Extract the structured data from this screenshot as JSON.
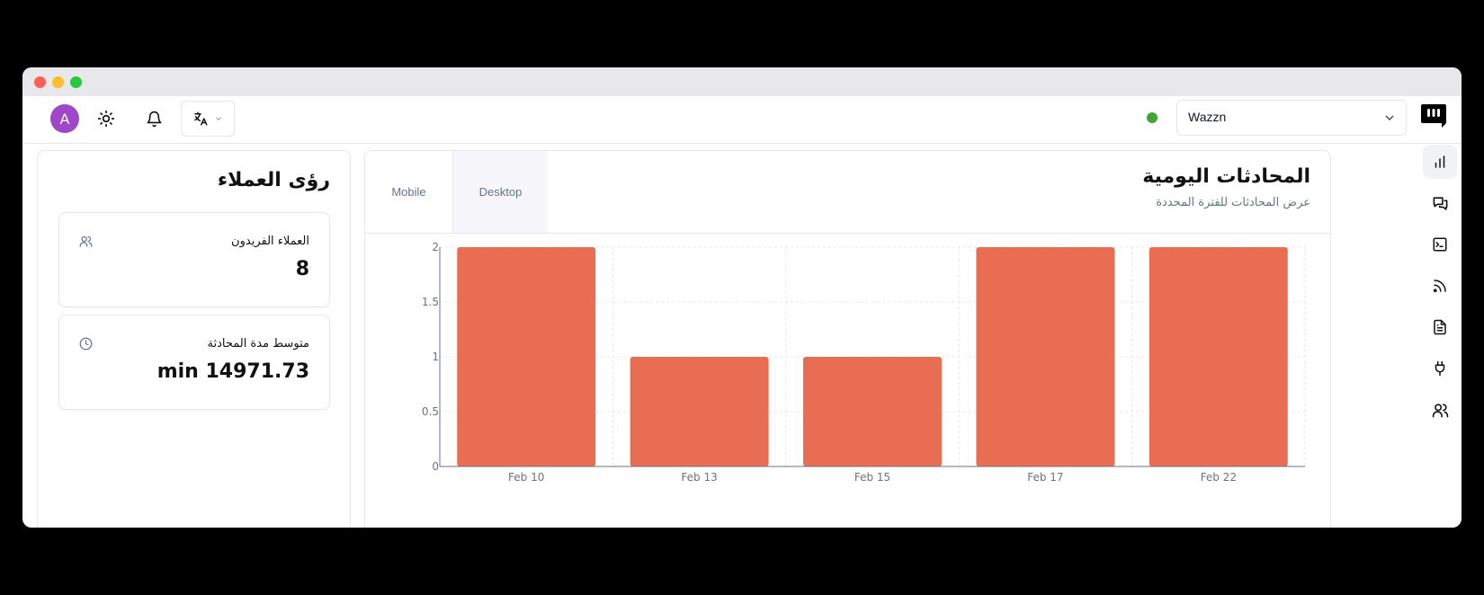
{
  "header": {
    "avatar_letter": "A",
    "workspace_select": "Wazzn",
    "colors": {
      "status_online": "#3fa535",
      "avatar": "#a046c9"
    }
  },
  "sidebar": {
    "items": [
      {
        "icon": "bar-chart-icon",
        "active": true
      },
      {
        "icon": "chat-icon"
      },
      {
        "icon": "terminal-icon"
      },
      {
        "icon": "rss-icon"
      },
      {
        "icon": "document-icon"
      },
      {
        "icon": "plug-icon"
      },
      {
        "icon": "users-icon"
      }
    ]
  },
  "insights": {
    "title": "رؤى العملاء",
    "unique_customers": {
      "label": "العملاء الفريدون",
      "value": "8"
    },
    "avg_duration": {
      "label": "متوسط مدة المحادثة",
      "value": "min 14971.73"
    }
  },
  "chart_panel": {
    "tabs": {
      "mobile": "Mobile",
      "desktop": "Desktop"
    },
    "title": "المحادثات اليومية",
    "subtitle": "عرض المحادثات للفترة المحددة"
  },
  "chart_data": {
    "type": "bar",
    "categories": [
      "Feb 10",
      "Feb 13",
      "Feb 15",
      "Feb 17",
      "Feb 22"
    ],
    "values": [
      2,
      1,
      1,
      2,
      2
    ],
    "ylim": [
      0,
      2
    ],
    "yticks": [
      "0",
      "0.5",
      "1",
      "1.5",
      "2"
    ],
    "grid": true,
    "bar_color": "#e96d53"
  }
}
